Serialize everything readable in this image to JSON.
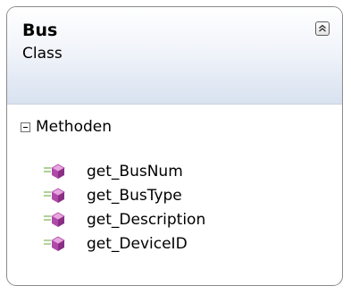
{
  "class_shape": {
    "name": "Bus",
    "stereotype": "Class",
    "collapse_icon": "double-chevron-up-icon",
    "compartment": {
      "label": "Methoden",
      "toggle_icon": "minus-box-icon",
      "methods": [
        {
          "label": "get_BusNum",
          "icon": "public-method-icon"
        },
        {
          "label": "get_BusType",
          "icon": "public-method-icon"
        },
        {
          "label": "get_Description",
          "icon": "public-method-icon"
        },
        {
          "label": "get_DeviceID",
          "icon": "public-method-icon"
        }
      ]
    }
  },
  "colors": {
    "header_gradient_end": "#d8e2f0",
    "border": "#8a8a8a",
    "method_icon": "#b04aa8"
  }
}
